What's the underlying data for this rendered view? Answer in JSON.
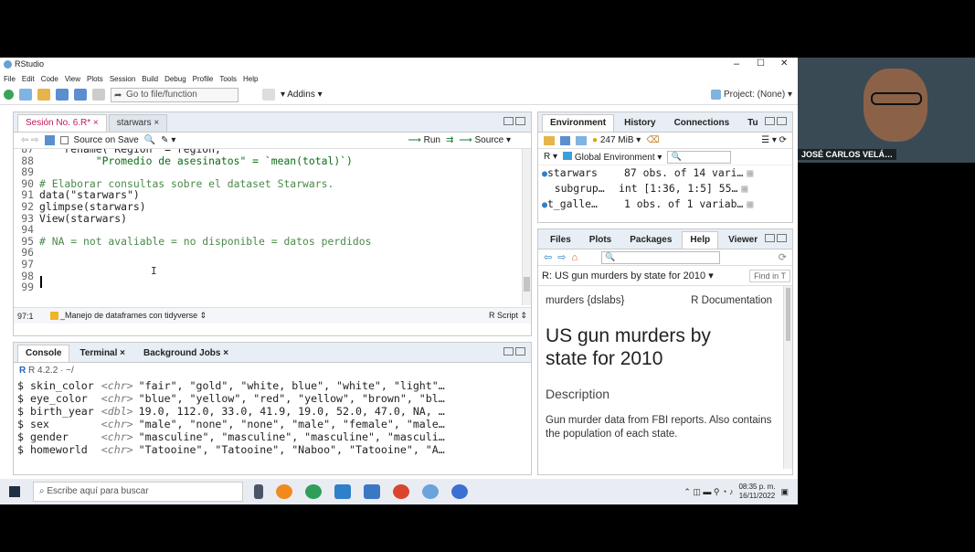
{
  "titlebar": {
    "app": "RStudio",
    "controls": [
      "–",
      "☐",
      "✕"
    ]
  },
  "menu": [
    "File",
    "Edit",
    "Code",
    "View",
    "Plots",
    "Session",
    "Build",
    "Debug",
    "Profile",
    "Tools",
    "Help"
  ],
  "toolbar": {
    "goto_placeholder": "Go to file/function",
    "addins": "Addins",
    "project": "Project: (None)"
  },
  "editor": {
    "tabs": [
      "Sesión No. 6.R*",
      "starwars"
    ],
    "source_on_save": "Source on Save",
    "run": "Run",
    "source": "Source",
    "lines": [
      {
        "n": "87",
        "code": "    rename(`Region` = region,"
      },
      {
        "n": "88",
        "code": "         \"Promedio de asesinatos\" = `mean(total)`)"
      },
      {
        "n": "89",
        "code": ""
      },
      {
        "n": "90",
        "code": "# Elaborar consultas sobre el dataset Starwars."
      },
      {
        "n": "91",
        "code": "data(\"starwars\")"
      },
      {
        "n": "92",
        "code": "glimpse(starwars)"
      },
      {
        "n": "93",
        "code": "View(starwars)"
      },
      {
        "n": "94",
        "code": ""
      },
      {
        "n": "95",
        "code": "# NA = not avaliable = no disponible = datos perdidos"
      },
      {
        "n": "96",
        "code": ""
      },
      {
        "n": "97",
        "code": ""
      },
      {
        "n": "98",
        "code": ""
      },
      {
        "n": "99",
        "code": ""
      }
    ],
    "status_pos": "97:1",
    "status_section": "_Manejo de dataframes con tidyverse",
    "status_type": "R Script"
  },
  "console": {
    "tabs": [
      "Console",
      "Terminal",
      "Background Jobs"
    ],
    "version": "R 4.2.2 · ~/",
    "rows": [
      {
        "name": "$ skin_color",
        "type": "<chr>",
        "vals": "\"fair\", \"gold\", \"white, blue\", \"white\", \"light\"…"
      },
      {
        "name": "$ eye_color ",
        "type": "<chr>",
        "vals": "\"blue\", \"yellow\", \"red\", \"yellow\", \"brown\", \"bl…"
      },
      {
        "name": "$ birth_year",
        "type": "<dbl>",
        "vals": "19.0, 112.0, 33.0, 41.9, 19.0, 52.0, 47.0, NA, …"
      },
      {
        "name": "$ sex       ",
        "type": "<chr>",
        "vals": "\"male\", \"none\", \"none\", \"male\", \"female\", \"male…"
      },
      {
        "name": "$ gender    ",
        "type": "<chr>",
        "vals": "\"masculine\", \"masculine\", \"masculine\", \"masculi…"
      },
      {
        "name": "$ homeworld ",
        "type": "<chr>",
        "vals": "\"Tatooine\", \"Tatooine\", \"Naboo\", \"Tatooine\", \"A…"
      }
    ]
  },
  "environment": {
    "tabs": [
      "Environment",
      "History",
      "Connections",
      "Tu"
    ],
    "memory": "247 MiB",
    "r_label": "R",
    "global": "Global Environment",
    "rows": [
      {
        "name": "starwars",
        "val": "87 obs. of 14 vari…"
      },
      {
        "name": "  subgrup…",
        "val": "int [1:36, 1:5] 55…"
      },
      {
        "name": "t_galle…",
        "val": "1 obs. of 1 variab…"
      }
    ]
  },
  "files": {
    "tabs": [
      "Files",
      "Plots",
      "Packages",
      "Help",
      "Viewer"
    ],
    "topic": "R: US gun murders by state for 2010",
    "find": "Find in T",
    "doc_pkg": "murders {dslabs}",
    "doc_type": "R Documentation",
    "doc_title": "US gun murders by state for 2010",
    "doc_heading": "Description",
    "doc_text": "Gun murder data from FBI reports. Also contains the population of each state."
  },
  "taskbar": {
    "search": "Escribe aquí para buscar",
    "time": "08:35 p. m.",
    "date": "16/11/2022"
  },
  "video": {
    "name": "JOSÉ CARLOS VELÁ…"
  },
  "colors": {
    "accent": "#c2185b",
    "tab_bg": "#e8eef5",
    "comment": "#4a8a4a",
    "string": "#0a6e16"
  }
}
